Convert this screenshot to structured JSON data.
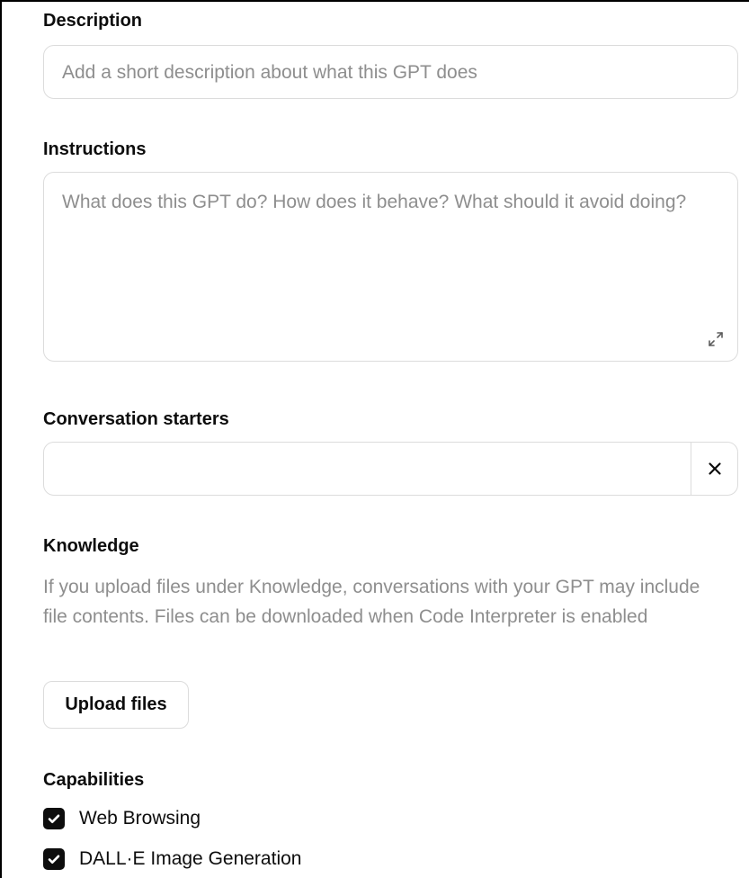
{
  "description": {
    "label": "Description",
    "placeholder": "Add a short description about what this GPT does",
    "value": ""
  },
  "instructions": {
    "label": "Instructions",
    "placeholder": "What does this GPT do? How does it behave? What should it avoid doing?",
    "value": ""
  },
  "conversation_starters": {
    "label": "Conversation starters",
    "items": [
      {
        "value": ""
      }
    ]
  },
  "knowledge": {
    "label": "Knowledge",
    "help_text": "If you upload files under Knowledge, conversations with your GPT may include file contents. Files can be downloaded when Code Interpreter is enabled",
    "upload_button": "Upload files"
  },
  "capabilities": {
    "label": "Capabilities",
    "items": [
      {
        "label": "Web Browsing",
        "checked": true
      },
      {
        "label": "DALL·E Image Generation",
        "checked": true
      }
    ]
  },
  "icons": {
    "expand": "expand-icon",
    "clear": "close-icon",
    "check": "checkmark-icon"
  },
  "colors": {
    "checkbox_fill": "#0d0d0d",
    "placeholder": "#8e8e8e",
    "border": "#dcdcdc"
  }
}
